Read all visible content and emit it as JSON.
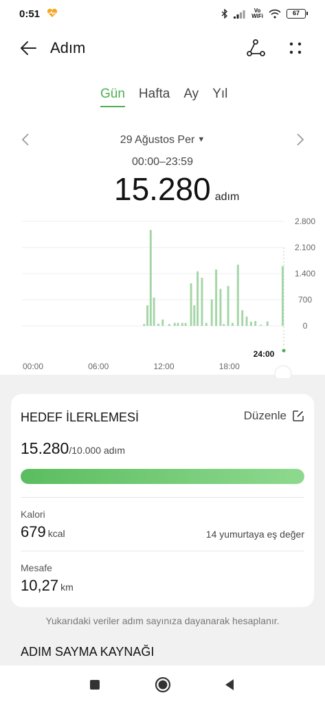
{
  "status_bar": {
    "time": "0:51",
    "vo_top": "Vo",
    "vo_bottom": "WiFi",
    "battery": "67"
  },
  "header": {
    "title": "Adım"
  },
  "tabs": [
    {
      "label": "Gün",
      "active": true
    },
    {
      "label": "Hafta",
      "active": false
    },
    {
      "label": "Ay",
      "active": false
    },
    {
      "label": "Yıl",
      "active": false
    }
  ],
  "date_nav": {
    "date": "29 Ağustos Per",
    "range": "00:00–23:59"
  },
  "summary": {
    "total": "15.280",
    "unit": "adım"
  },
  "chart_data": {
    "type": "bar",
    "ylim": [
      0,
      2800
    ],
    "yticks": [
      "2.800",
      "2.100",
      "1.400",
      "700",
      "0"
    ],
    "ytick_values": [
      2800,
      2100,
      1400,
      700,
      0
    ],
    "xticks": [
      "00:00",
      "06:00",
      "12:00",
      "18:00",
      "24:00"
    ],
    "xtick_hours": [
      0,
      6,
      12,
      18,
      24
    ],
    "bar_color": "#a5d6a7",
    "marker_label": "24:00",
    "hours": [
      11.2,
      11.5,
      11.8,
      12.1,
      12.5,
      12.9,
      13.5,
      14.0,
      14.3,
      14.7,
      15.0,
      15.5,
      15.8,
      16.1,
      16.5,
      16.9,
      17.4,
      17.8,
      18.2,
      18.5,
      18.9,
      19.3,
      19.8,
      20.2,
      20.6,
      21.0,
      21.4,
      21.9,
      22.5,
      23.9
    ],
    "values": [
      50,
      550,
      2570,
      760,
      60,
      170,
      50,
      80,
      80,
      80,
      80,
      1140,
      550,
      1460,
      1290,
      80,
      710,
      1510,
      990,
      50,
      1070,
      80,
      1640,
      420,
      250,
      110,
      130,
      30,
      120,
      1600
    ]
  },
  "goal": {
    "title": "HEDEF İLERLEMESİ",
    "edit_label": "Düzenle",
    "current": "15.280",
    "target_text": "/10.000 adım",
    "progress_fraction": 1.0
  },
  "calories": {
    "label": "Kalori",
    "value": "679",
    "unit": "kcal",
    "equivalent": "14 yumurtaya eş değer"
  },
  "distance": {
    "label": "Mesafe",
    "value": "10,27",
    "unit": "km"
  },
  "footnote": "Yukarıdaki veriler adım sayınıza dayanarak hesaplanır.",
  "source_section": {
    "title": "ADIM SAYMA KAYNAĞI"
  },
  "colors": {
    "accent": "#4caf50",
    "bar": "#a5d6a7"
  }
}
